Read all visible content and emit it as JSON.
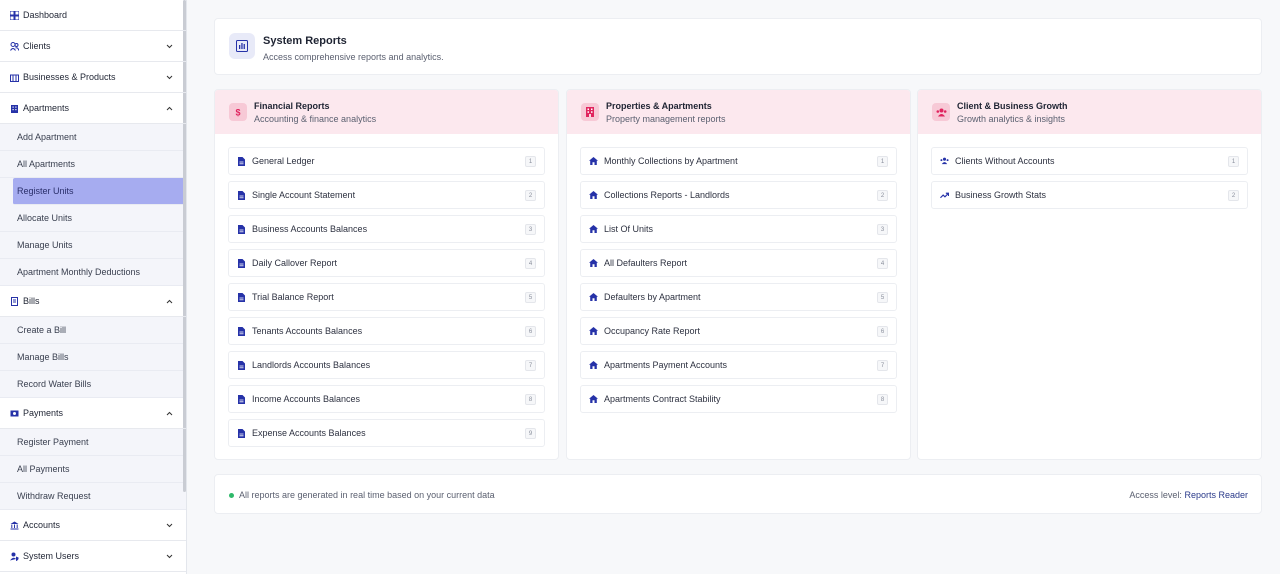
{
  "sidebar": {
    "dashboard": "Dashboard",
    "clients": "Clients",
    "businesses": "Businesses & Products",
    "apartments": {
      "label": "Apartments",
      "items": [
        "Add Apartment",
        "All Apartments",
        "Register Units",
        "Allocate Units",
        "Manage Units",
        "Apartment Monthly Deductions"
      ],
      "active": "Register Units"
    },
    "bills": {
      "label": "Bills",
      "items": [
        "Create a Bill",
        "Manage Bills",
        "Record Water Bills"
      ]
    },
    "payments": {
      "label": "Payments",
      "items": [
        "Register Payment",
        "All Payments",
        "Withdraw Request"
      ]
    },
    "accounts": "Accounts",
    "system_users": "System Users"
  },
  "header": {
    "title": "System Reports",
    "subtitle": "Access comprehensive reports and analytics."
  },
  "columns": [
    {
      "title": "Financial Reports",
      "subtitle": "Accounting & finance analytics",
      "icon": "dollar-icon",
      "accent": "#e0245e",
      "items": [
        {
          "label": "General Ledger",
          "num": "1"
        },
        {
          "label": "Single Account Statement",
          "num": "2"
        },
        {
          "label": "Business Accounts Balances",
          "num": "3"
        },
        {
          "label": "Daily Callover Report",
          "num": "4"
        },
        {
          "label": "Trial Balance Report",
          "num": "5"
        },
        {
          "label": "Tenants Accounts Balances",
          "num": "6"
        },
        {
          "label": "Landlords Accounts Balances",
          "num": "7"
        },
        {
          "label": "Income Accounts Balances",
          "num": "8"
        },
        {
          "label": "Expense Accounts Balances",
          "num": "9"
        }
      ]
    },
    {
      "title": "Properties & Apartments",
      "subtitle": "Property management reports",
      "icon": "building-icon",
      "accent": "#e0245e",
      "items": [
        {
          "label": "Monthly Collections by Apartment",
          "num": "1"
        },
        {
          "label": "Collections Reports - Landlords",
          "num": "2"
        },
        {
          "label": "List Of Units",
          "num": "3"
        },
        {
          "label": "All Defaulters Report",
          "num": "4"
        },
        {
          "label": "Defaulters by Apartment",
          "num": "5"
        },
        {
          "label": "Occupancy Rate Report",
          "num": "6"
        },
        {
          "label": "Apartments Payment Accounts",
          "num": "7"
        },
        {
          "label": "Apartments Contract Stability",
          "num": "8"
        }
      ]
    },
    {
      "title": "Client & Business Growth",
      "subtitle": "Growth analytics & insights",
      "icon": "users-icon",
      "accent": "#e0245e",
      "items": [
        {
          "label": "Clients Without Accounts",
          "num": "1"
        },
        {
          "label": "Business Growth Stats",
          "num": "2"
        }
      ]
    }
  ],
  "footer": {
    "note": "All reports are generated in real time based on your current data",
    "access_prefix": "Access level:",
    "access_value": "Reports Reader"
  },
  "colors": {
    "brand": "#2632a8",
    "accent_bg": "#fce8ee",
    "active_item": "#a6acf0",
    "status_dot": "#2fb96a"
  }
}
